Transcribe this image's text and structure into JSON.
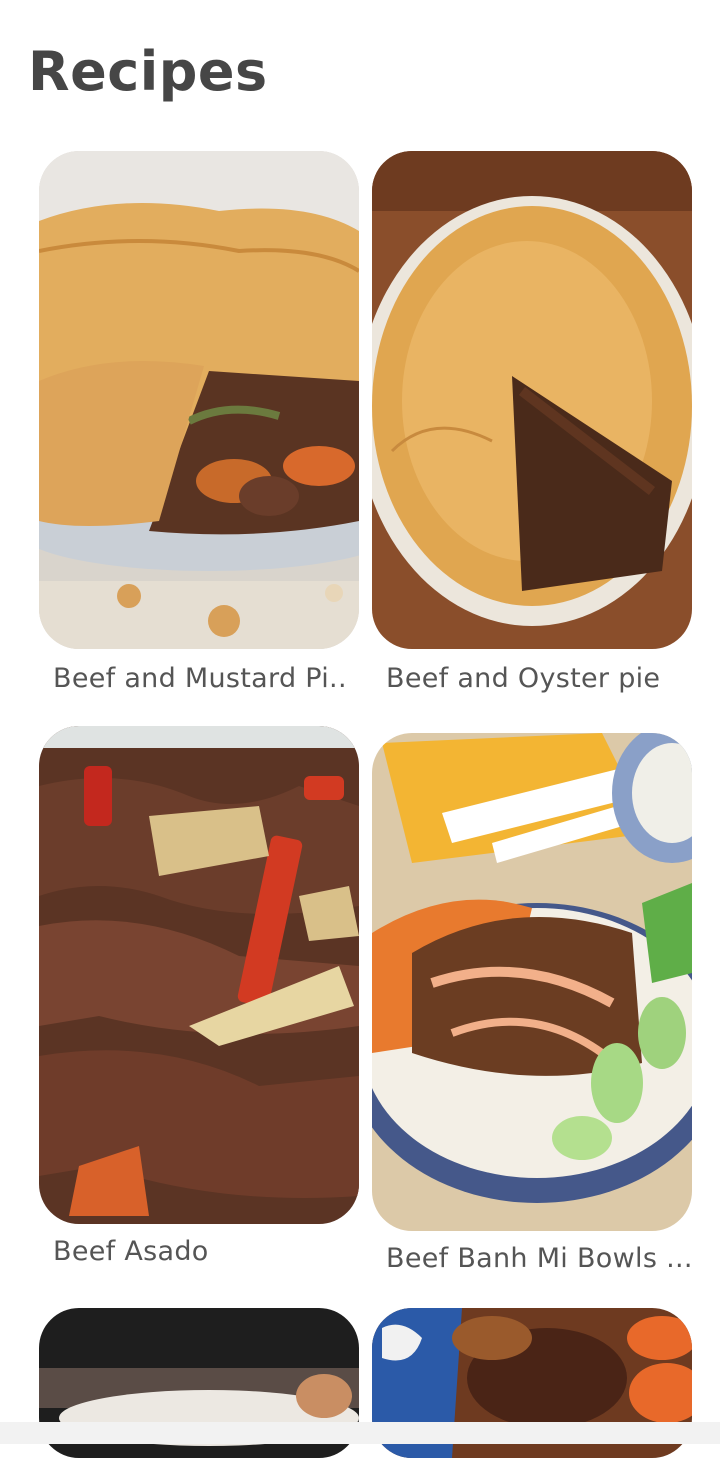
{
  "header": {
    "title": "Recipes"
  },
  "recipes": [
    {
      "name": "Beef and Mustard Pi.."
    },
    {
      "name": "Beef and Oyster pie"
    },
    {
      "name": "Beef Asado"
    },
    {
      "name": "Beef Banh Mi Bowls ..."
    },
    {
      "name": ""
    },
    {
      "name": ""
    }
  ]
}
